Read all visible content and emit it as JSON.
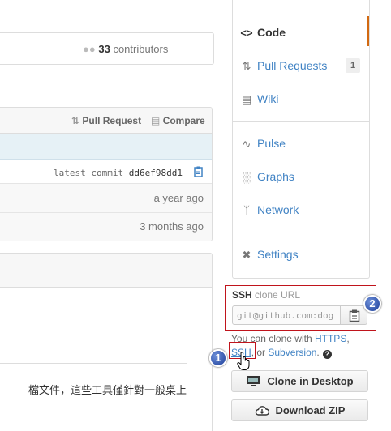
{
  "summary": {
    "contributors_count": "33",
    "contributors_label": "contributors"
  },
  "file_header": {
    "pull_request": "Pull Request",
    "compare": "Compare"
  },
  "latest_commit": {
    "label": "latest commit",
    "sha": "dd6ef98dd1"
  },
  "file_rows": [
    {
      "age": "a year ago"
    },
    {
      "age": "3 months ago"
    }
  ],
  "readme": {
    "text": "檔文件，這些工具僅針對一般桌上"
  },
  "sidebar": {
    "nav": [
      {
        "label": "Code",
        "icon": "code-icon"
      },
      {
        "label": "Pull Requests",
        "icon": "pull-request-icon",
        "count": "1"
      },
      {
        "label": "Wiki",
        "icon": "book-icon"
      },
      {
        "label": "Pulse",
        "icon": "pulse-icon"
      },
      {
        "label": "Graphs",
        "icon": "graph-icon"
      },
      {
        "label": "Network",
        "icon": "branch-icon"
      },
      {
        "label": "Settings",
        "icon": "tools-icon"
      }
    ],
    "clone": {
      "protocol": "SSH",
      "title_suffix": "clone URL",
      "url": "git@github.com:dog",
      "help_prefix": "You can clone with",
      "https": "HTTPS",
      "comma": ",",
      "ssh": "SSH",
      "or": ", or",
      "subversion": "Subversion",
      "period": ".",
      "help_icon": "?"
    },
    "buttons": {
      "clone_desktop": "Clone in Desktop",
      "download_zip": "Download ZIP"
    }
  },
  "annotations": {
    "badge1": "1",
    "badge2": "2",
    "color": "#c0141c"
  }
}
